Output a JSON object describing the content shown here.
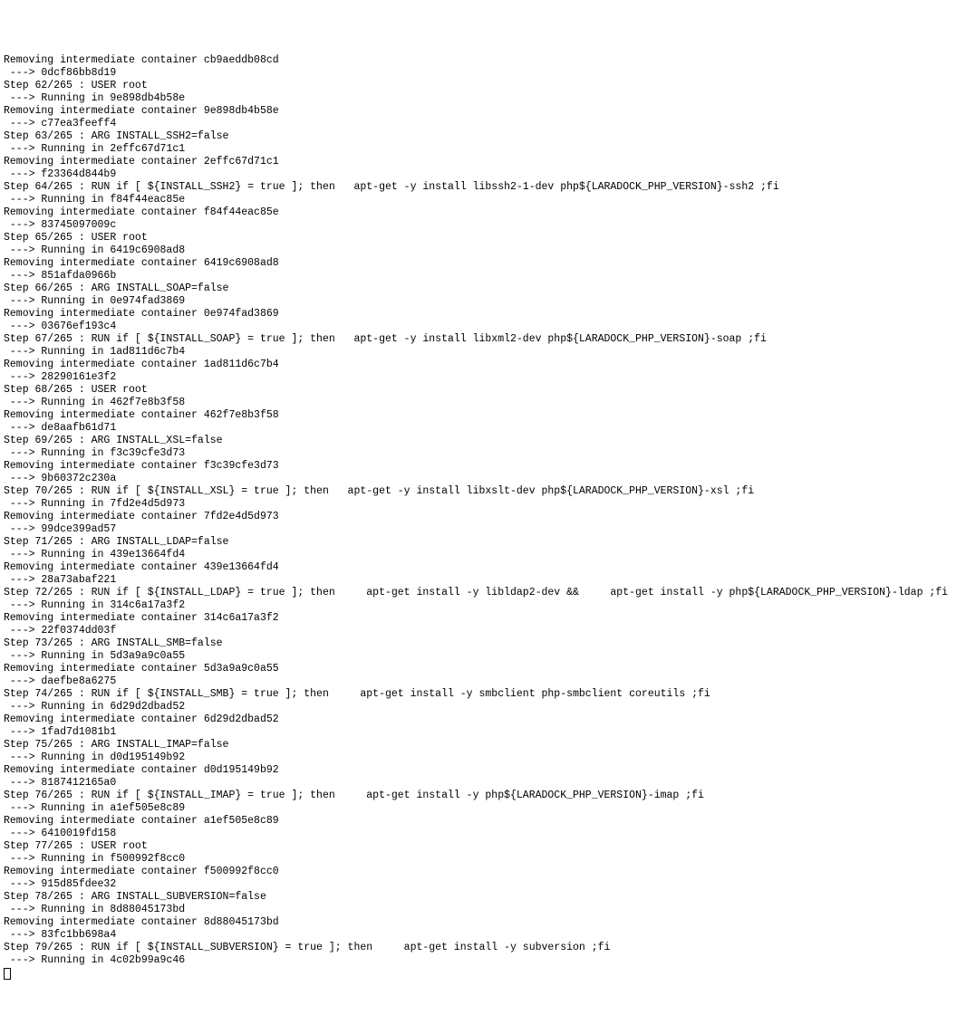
{
  "terminal": {
    "lines": [
      "Removing intermediate container cb9aeddb08cd",
      " ---> 0dcf86bb8d19",
      "Step 62/265 : USER root",
      " ---> Running in 9e898db4b58e",
      "Removing intermediate container 9e898db4b58e",
      " ---> c77ea3feeff4",
      "Step 63/265 : ARG INSTALL_SSH2=false",
      " ---> Running in 2effc67d71c1",
      "Removing intermediate container 2effc67d71c1",
      " ---> f23364d844b9",
      "Step 64/265 : RUN if [ ${INSTALL_SSH2} = true ]; then   apt-get -y install libssh2-1-dev php${LARADOCK_PHP_VERSION}-ssh2 ;fi",
      " ---> Running in f84f44eac85e",
      "Removing intermediate container f84f44eac85e",
      " ---> 83745097009c",
      "Step 65/265 : USER root",
      " ---> Running in 6419c6908ad8",
      "Removing intermediate container 6419c6908ad8",
      " ---> 851afda0966b",
      "Step 66/265 : ARG INSTALL_SOAP=false",
      " ---> Running in 0e974fad3869",
      "Removing intermediate container 0e974fad3869",
      " ---> 03676ef193c4",
      "Step 67/265 : RUN if [ ${INSTALL_SOAP} = true ]; then   apt-get -y install libxml2-dev php${LARADOCK_PHP_VERSION}-soap ;fi",
      " ---> Running in 1ad811d6c7b4",
      "Removing intermediate container 1ad811d6c7b4",
      " ---> 28290161e3f2",
      "Step 68/265 : USER root",
      " ---> Running in 462f7e8b3f58",
      "Removing intermediate container 462f7e8b3f58",
      " ---> de8aafb61d71",
      "Step 69/265 : ARG INSTALL_XSL=false",
      " ---> Running in f3c39cfe3d73",
      "Removing intermediate container f3c39cfe3d73",
      " ---> 9b60372c230a",
      "Step 70/265 : RUN if [ ${INSTALL_XSL} = true ]; then   apt-get -y install libxslt-dev php${LARADOCK_PHP_VERSION}-xsl ;fi",
      " ---> Running in 7fd2e4d5d973",
      "Removing intermediate container 7fd2e4d5d973",
      " ---> 99dce399ad57",
      "Step 71/265 : ARG INSTALL_LDAP=false",
      " ---> Running in 439e13664fd4",
      "Removing intermediate container 439e13664fd4",
      " ---> 28a73abaf221",
      "Step 72/265 : RUN if [ ${INSTALL_LDAP} = true ]; then     apt-get install -y libldap2-dev &&     apt-get install -y php${LARADOCK_PHP_VERSION}-ldap ;fi",
      " ---> Running in 314c6a17a3f2",
      "Removing intermediate container 314c6a17a3f2",
      " ---> 22f0374dd03f",
      "Step 73/265 : ARG INSTALL_SMB=false",
      " ---> Running in 5d3a9a9c0a55",
      "Removing intermediate container 5d3a9a9c0a55",
      " ---> daefbe8a6275",
      "Step 74/265 : RUN if [ ${INSTALL_SMB} = true ]; then     apt-get install -y smbclient php-smbclient coreutils ;fi",
      " ---> Running in 6d29d2dbad52",
      "Removing intermediate container 6d29d2dbad52",
      " ---> 1fad7d1081b1",
      "Step 75/265 : ARG INSTALL_IMAP=false",
      " ---> Running in d0d195149b92",
      "Removing intermediate container d0d195149b92",
      " ---> 8187412165a0",
      "Step 76/265 : RUN if [ ${INSTALL_IMAP} = true ]; then     apt-get install -y php${LARADOCK_PHP_VERSION}-imap ;fi",
      " ---> Running in a1ef505e8c89",
      "Removing intermediate container a1ef505e8c89",
      " ---> 6410019fd158",
      "Step 77/265 : USER root",
      " ---> Running in f500992f8cc0",
      "Removing intermediate container f500992f8cc0",
      " ---> 915d85fdee32",
      "Step 78/265 : ARG INSTALL_SUBVERSION=false",
      " ---> Running in 8d88045173bd",
      "Removing intermediate container 8d88045173bd",
      " ---> 83fc1bb698a4",
      "Step 79/265 : RUN if [ ${INSTALL_SUBVERSION} = true ]; then     apt-get install -y subversion ;fi",
      " ---> Running in 4c02b99a9c46"
    ]
  }
}
